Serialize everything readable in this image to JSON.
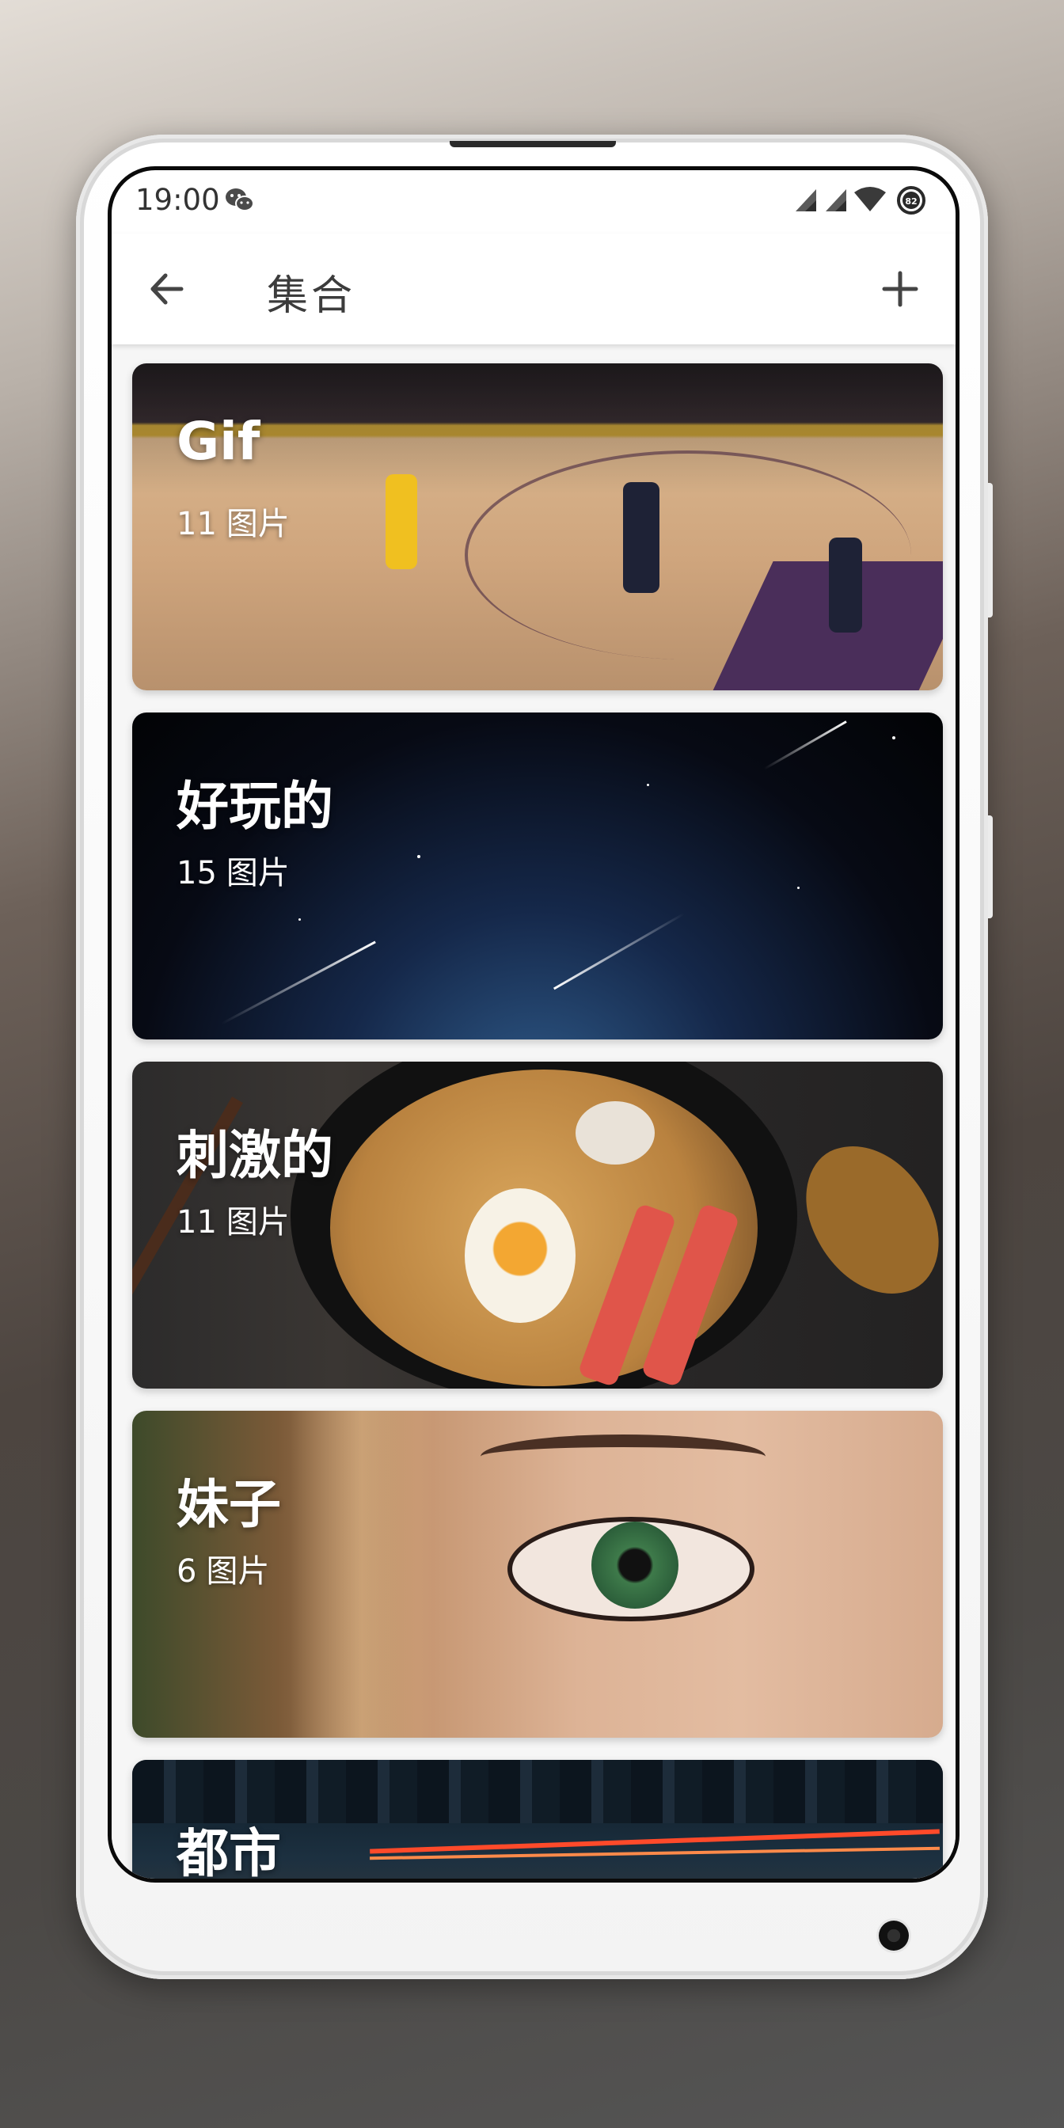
{
  "status_bar": {
    "time": "19:00",
    "battery": "82",
    "icons": [
      "wechat-icon",
      "signal-icon",
      "signal-icon",
      "wifi-icon",
      "battery-icon"
    ]
  },
  "app_bar": {
    "title": "集合",
    "back_icon": "arrow-left-icon",
    "add_icon": "plus-icon"
  },
  "collections": [
    {
      "title": "Gif",
      "count": "11",
      "unit": "图片",
      "scene": "basketball-court"
    },
    {
      "title": "好玩的",
      "count": "15",
      "unit": "图片",
      "scene": "starry-night-sky"
    },
    {
      "title": "刺激的",
      "count": "11",
      "unit": "图片",
      "scene": "noodle-bowl"
    },
    {
      "title": "妹子",
      "count": "6",
      "unit": "图片",
      "scene": "eye-closeup"
    },
    {
      "title": "都市",
      "count": "",
      "unit": "",
      "scene": "city-night"
    }
  ],
  "colors": {
    "app_bar_bg": "#ffffff",
    "title_text": "#3c3c3c",
    "card_text": "#ffffff"
  }
}
